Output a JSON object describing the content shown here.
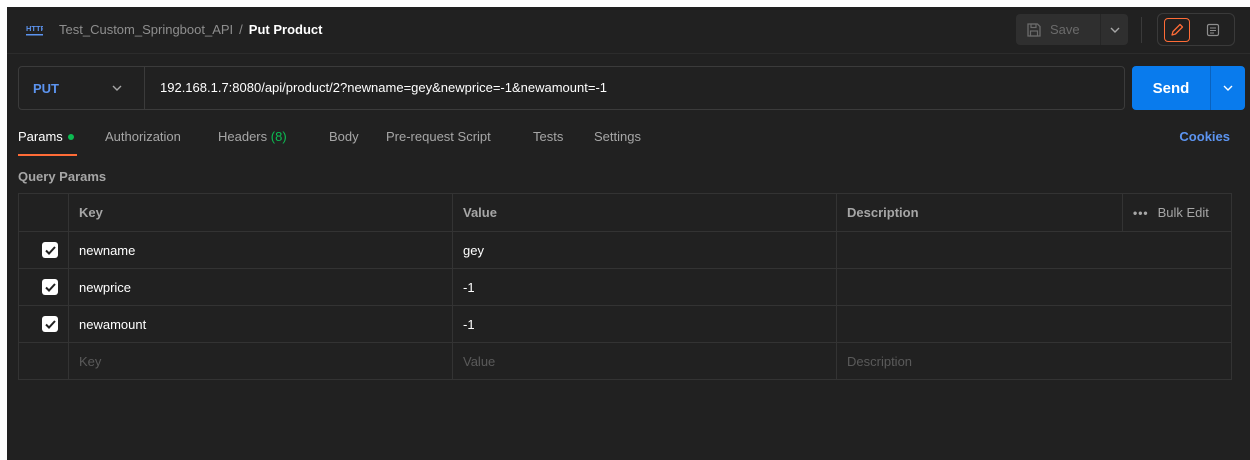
{
  "header": {
    "collection": "Test_Custom_Springboot_API",
    "separator": "/",
    "request_name": "Put Product",
    "save_label": "Save"
  },
  "request": {
    "method": "PUT",
    "url": "192.168.1.7:8080/api/product/2?newname=gey&newprice=-1&newamount=-1",
    "send_label": "Send"
  },
  "tabs": [
    {
      "label": "Params",
      "active": true
    },
    {
      "label": "Authorization"
    },
    {
      "label": "Headers",
      "count": "(8)"
    },
    {
      "label": "Body"
    },
    {
      "label": "Pre-request Script"
    },
    {
      "label": "Tests"
    },
    {
      "label": "Settings"
    }
  ],
  "cookies_label": "Cookies",
  "query_params": {
    "title": "Query Params",
    "columns": [
      "Key",
      "Value",
      "Description"
    ],
    "bulk_edit_label": "Bulk Edit",
    "rows": [
      {
        "checked": true,
        "key": "newname",
        "value": "gey",
        "description": ""
      },
      {
        "checked": true,
        "key": "newprice",
        "value": "-1",
        "description": ""
      },
      {
        "checked": true,
        "key": "newamount",
        "value": "-1",
        "description": ""
      }
    ],
    "placeholders": {
      "key": "Key",
      "value": "Value",
      "description": "Description"
    }
  },
  "colors": {
    "background": "#212121",
    "accent": "#ff6c37",
    "method": "#5c94f0",
    "send": "#097bed",
    "green": "#0cbb52"
  }
}
